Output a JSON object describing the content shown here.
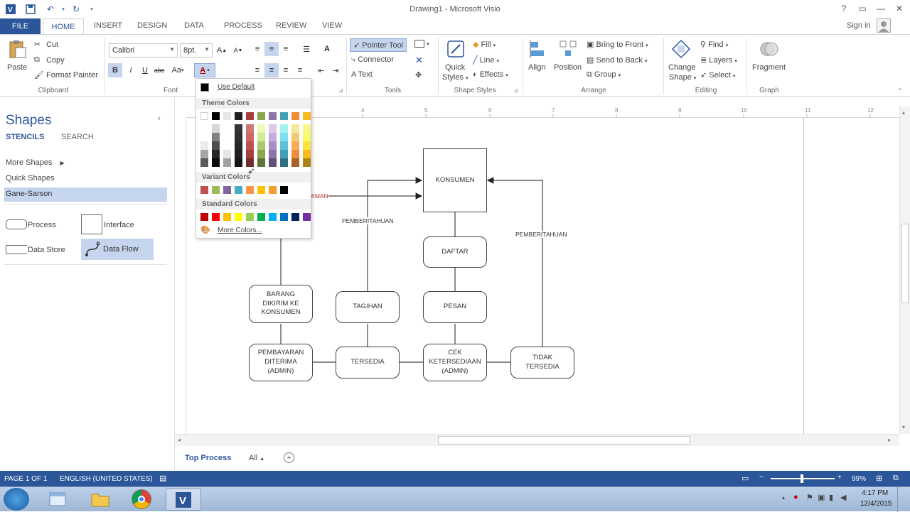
{
  "window": {
    "title": "Drawing1 - Microsoft Visio",
    "sign_in": "Sign in",
    "help": "?",
    "minimize": "—",
    "restore": "❐",
    "close": "✕"
  },
  "tabs": [
    "FILE",
    "HOME",
    "INSERT",
    "DESIGN",
    "DATA",
    "PROCESS",
    "REVIEW",
    "VIEW"
  ],
  "ribbon": {
    "clipboard": {
      "paste": "Paste",
      "cut": "Cut",
      "copy": "Copy",
      "format_painter": "Format Painter",
      "label": "Clipboard"
    },
    "font": {
      "font_name": "Calibri",
      "font_size": "8pt.",
      "grow": "A",
      "shrink": "A",
      "bold": "B",
      "italic": "I",
      "underline": "U",
      "strike": "abc",
      "case": "Aa",
      "label": "Font"
    },
    "paragraph": {
      "label": ""
    },
    "tools": {
      "pointer": "Pointer Tool",
      "connector": "Connector",
      "text": "Text",
      "label": "Tools"
    },
    "shape_styles": {
      "quick_styles": "Quick",
      "quick_styles2": "Styles",
      "fill": "Fill",
      "line": "Line",
      "effects": "Effects",
      "label": "Shape Styles"
    },
    "arrange": {
      "align": "Align",
      "position": "Position",
      "bring_front": "Bring to Front",
      "send_back": "Send to Back",
      "group": "Group",
      "label": "Arrange"
    },
    "editing": {
      "change_shape": "Change",
      "change_shape2": "Shape",
      "find": "Find",
      "layers": "Layers",
      "select": "Select",
      "label": "Editing"
    },
    "graph": {
      "fragment": "Fragment",
      "label": "Graph"
    }
  },
  "shapes_pane": {
    "title": "Shapes",
    "tab_stencils": "STENCILS",
    "tab_search": "SEARCH",
    "more_shapes": "More Shapes",
    "quick_shapes": "Quick Shapes",
    "stencil": "Gane-Sarson",
    "items": [
      "Process",
      "Interface",
      "Data Store",
      "Data Flow"
    ]
  },
  "ruler": {
    "top": [
      "4",
      "5",
      "6",
      "7",
      "8",
      "9",
      "10",
      "11",
      "12"
    ]
  },
  "color_dropdown": {
    "use_default": "Use Default",
    "theme_colors": "Theme Colors",
    "variant_colors": "Variant Colors",
    "standard_colors": "Standard Colors",
    "more_colors": "More Colors...",
    "theme_top": [
      "#ffffff",
      "#000000",
      "#e7e6e6",
      "#1f1f1f",
      "#a5403f",
      "#8aa650",
      "#8b74a8",
      "#42a0b6",
      "#ef8c3a",
      "#f9ba1d"
    ],
    "variant": [
      "#c0504d",
      "#9bbb59",
      "#8064a2",
      "#4bacc6",
      "#f79646",
      "#ffc000",
      "#f0a030",
      "#000000"
    ],
    "standard": [
      "#c00000",
      "#ff0000",
      "#ffc000",
      "#ffff00",
      "#92d050",
      "#00b050",
      "#00b0f0",
      "#0070c0",
      "#002060",
      "#7030a0"
    ]
  },
  "diagram": {
    "konsumen": "KONSUMEN",
    "daftar": "DAFTAR",
    "pesan": "PESAN",
    "tagihan": "TAGIHAN",
    "barang": "BARANG DIKIRIM KE KONSUMEN",
    "pembayaran": "PEMBAYARAN DITERIMA (ADMIN)",
    "tersedia": "TERSEDIA",
    "cek": "CEK KETERSEDIAAN (ADMIN)",
    "tidak": "TIDAK TERSEDIA",
    "label_pemberitahuan_1": "PEMBERITAHUAN",
    "label_pemberitahuan_2": "PEMBERITAHUAN",
    "label_partial": "IRIMAN"
  },
  "page_tabs": {
    "active": "Top Process",
    "all": "All",
    "add": "+"
  },
  "status": {
    "page": "PAGE 1 OF 1",
    "language": "ENGLISH (UNITED STATES)",
    "zoom": "99%"
  },
  "taskbar": {
    "time": "4:17 PM",
    "date": "12/4/2015"
  },
  "colors": {
    "accent": "#2b579a",
    "selected": "#c5d5ee"
  }
}
